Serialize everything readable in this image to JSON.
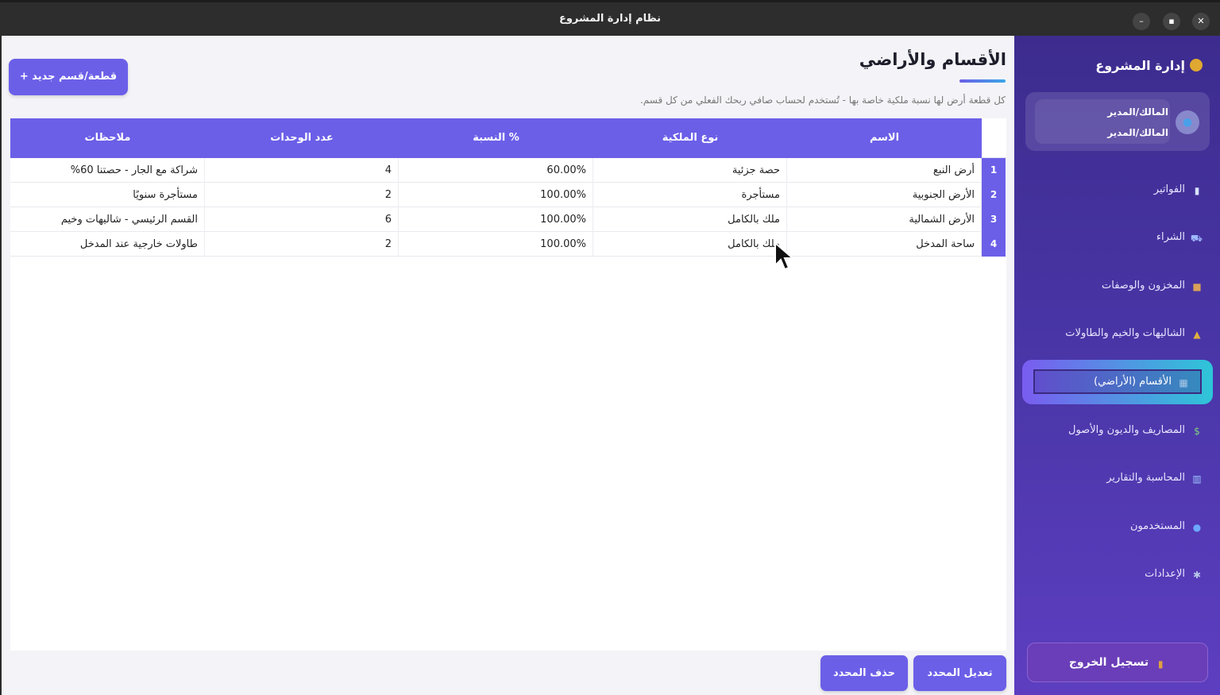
{
  "window": {
    "title": "نظام إدارة المشروع"
  },
  "main": {
    "add_button": "قطعة/قسم جديد +",
    "title": "الأقسام والأراضي",
    "subtitle": "كل قطعة أرض لها نسبة ملكية خاصة بها - تُستخدم لحساب صافي ربحك الفعلي من كل قسم.",
    "table": {
      "headers": {
        "name": "الاسم",
        "ownership": "نوع الملكية",
        "percent": "% النسبة",
        "units": "عدد الوحدات",
        "notes": "ملاحظات"
      },
      "rows": [
        {
          "num": "1",
          "name": "أرض النبع",
          "ownership": "حصة جزئية",
          "percent": "60.00%",
          "units": "4",
          "notes": "شراكة مع الجار - حصتنا 60%"
        },
        {
          "num": "2",
          "name": "الأرض الجنوبية",
          "ownership": "مستأجرة",
          "percent": "100.00%",
          "units": "2",
          "notes": "مستأجرة سنويًا"
        },
        {
          "num": "3",
          "name": "الأرض الشمالية",
          "ownership": "ملك بالكامل",
          "percent": "100.00%",
          "units": "6",
          "notes": "القسم الرئيسي - شاليهات وخيم"
        },
        {
          "num": "4",
          "name": "ساحة المدخل",
          "ownership": "ملك بالكامل",
          "percent": "100.00%",
          "units": "2",
          "notes": "طاولات خارجية عند المدخل"
        }
      ]
    },
    "edit_button": "تعديل المحدد",
    "delete_button": "حذف المحدد"
  },
  "sidebar": {
    "brand": "إدارة المشروع",
    "user": {
      "line1": "المالك/المدير",
      "line2": "المالك/المدير"
    },
    "items": [
      {
        "label": "الفواتير",
        "icon": "receipt-icon"
      },
      {
        "label": "الشراء",
        "icon": "cart-icon"
      },
      {
        "label": "المخزون والوصفات",
        "icon": "box-icon"
      },
      {
        "label": "الشاليهات والخيم والطاولات",
        "icon": "tent-icon"
      },
      {
        "label": "الأقسام (الأراضي)",
        "icon": "map-icon",
        "active": true
      },
      {
        "label": "المصاريف والديون والأصول",
        "icon": "money-icon"
      },
      {
        "label": "المحاسبة والتقارير",
        "icon": "chart-icon"
      },
      {
        "label": "المستخدمون",
        "icon": "users-icon"
      },
      {
        "label": "الإعدادات",
        "icon": "gear-icon"
      }
    ],
    "logout": "تسجيل الخروج"
  },
  "colors": {
    "accent": "#6b5fe8",
    "sidebar_top": "#3d2c8e",
    "sidebar_bottom": "#5d3ec0",
    "active_end": "#2ec6d8"
  }
}
